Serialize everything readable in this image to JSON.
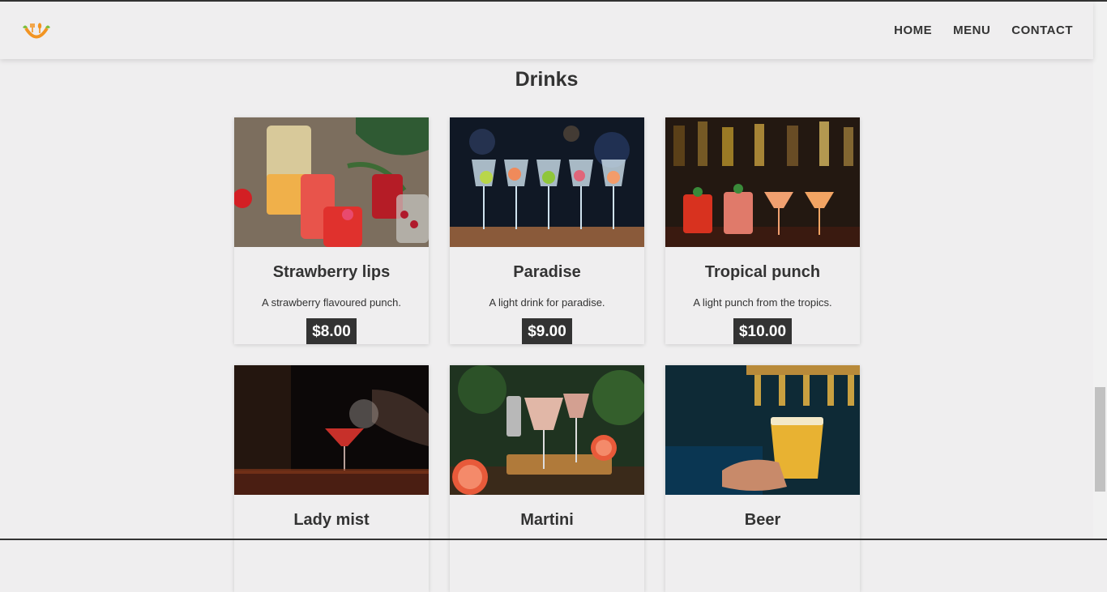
{
  "nav": {
    "logo": "logo-icon",
    "links": [
      "HOME",
      "MENU",
      "CONTACT"
    ]
  },
  "page": {
    "title": "Drinks"
  },
  "drinks": [
    {
      "name": "Strawberry lips",
      "description": "A strawberry flavoured punch.",
      "price": "$8.00",
      "image": "strawberry-cocktail-image"
    },
    {
      "name": "Paradise",
      "description": "A light drink for paradise.",
      "price": "$9.00",
      "image": "gin-glasses-image"
    },
    {
      "name": "Tropical punch",
      "description": "A light punch from the tropics.",
      "price": "$10.00",
      "image": "bar-cocktails-image"
    },
    {
      "name": "Lady mist",
      "description": "",
      "price": "",
      "image": "bartender-cocktail-image"
    },
    {
      "name": "Martini",
      "description": "",
      "price": "",
      "image": "grapefruit-cocktail-image"
    },
    {
      "name": "Beer",
      "description": "",
      "price": "",
      "image": "beer-tap-image"
    }
  ],
  "colors": {
    "background": "#efeeef",
    "text": "#333333",
    "price_bg": "#333333",
    "price_text": "#ffffff",
    "logo_orange": "#f29422",
    "logo_green": "#7bbf3a"
  }
}
